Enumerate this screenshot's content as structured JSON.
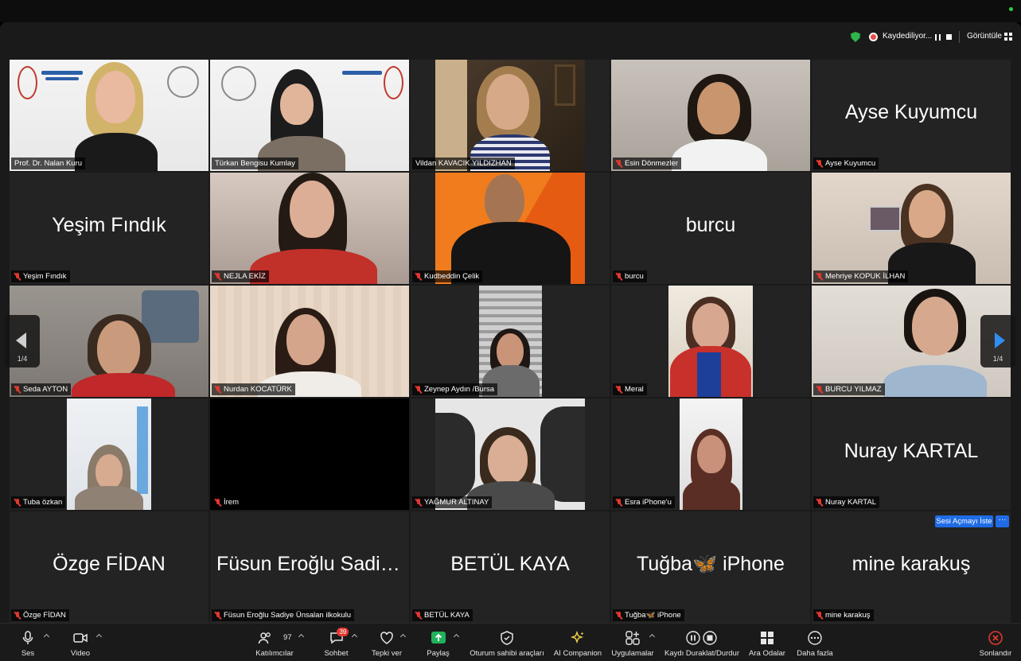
{
  "recording": {
    "label": "Kaydediliyor..."
  },
  "view": {
    "label": "Görüntüle"
  },
  "participants": [
    {
      "name": "Prof. Dr. Nalan Kuru",
      "muted": false
    },
    {
      "name": "Türkan Bengisu Kumlay",
      "muted": false
    },
    {
      "name": "Vildan KAVACIK  YILDIZHAN",
      "muted": false
    },
    {
      "name": "Esin Dönmezler",
      "muted": true
    },
    {
      "name": "Ayse Kuyumcu",
      "muted": true,
      "display": "Ayse Kuyumcu"
    },
    {
      "name": "Yeşim Fındık",
      "muted": true,
      "display": "Yeşim Fındık"
    },
    {
      "name": "NEJLA EKİZ",
      "muted": true
    },
    {
      "name": "Kudbeddin Çelik",
      "muted": true
    },
    {
      "name": "burcu",
      "muted": true,
      "display": "burcu"
    },
    {
      "name": "Mehriye KOPUK İLHAN",
      "muted": true
    },
    {
      "name": "Seda AYTON",
      "muted": true
    },
    {
      "name": "Nurdan KOCATÜRK",
      "muted": true
    },
    {
      "name": "Zeynep Aydın /Bursa",
      "muted": true
    },
    {
      "name": "Meral",
      "muted": true
    },
    {
      "name": "BURCU YILMAZ",
      "muted": true
    },
    {
      "name": "Tuba özkan",
      "muted": true
    },
    {
      "name": "İrem",
      "muted": true
    },
    {
      "name": "YAĞMUR ALTINAY",
      "muted": true
    },
    {
      "name": "Esra iPhone'u",
      "muted": true
    },
    {
      "name": "Nuray KARTAL",
      "muted": true,
      "display": "Nuray KARTAL"
    },
    {
      "name": "Özge FİDAN",
      "muted": true,
      "display": "Özge FİDAN"
    },
    {
      "name": "Füsun Eroğlu Sadiye Ünsalan ilkokulu",
      "muted": true,
      "display": "Füsun Eroğlu Sadiy..."
    },
    {
      "name": "BETÜL KAYA",
      "muted": true,
      "display": "BETÜL KAYA"
    },
    {
      "name": "Tuğba🦋 iPhone",
      "muted": true,
      "display": "Tuğba🦋 iPhone"
    },
    {
      "name": "mine karakuş",
      "muted": true,
      "display": "mine karakuş"
    }
  ],
  "pagination": {
    "left": "1/4",
    "right": "1/4"
  },
  "ask_unmute": {
    "label": "Sesi Açmayı İste",
    "more": "···"
  },
  "toolbar": {
    "audio": "Ses",
    "video": "Video",
    "participants": "Katılımcılar",
    "participants_count": "97",
    "chat": "Sohbet",
    "chat_badge": "39",
    "react": "Tepki ver",
    "share": "Paylaş",
    "host_tools": "Oturum sahibi araçları",
    "ai": "AI Companion",
    "apps": "Uygulamalar",
    "record": "Kaydı Duraklat/Durdur",
    "breakout": "Ara Odalar",
    "more": "Daha fazla",
    "end": "Sonlandır"
  },
  "colors": {
    "mute_red": "#e0382f",
    "active_green": "#2fc34a",
    "accent_blue": "#1f6ce6",
    "tile_bg": "#232323"
  }
}
